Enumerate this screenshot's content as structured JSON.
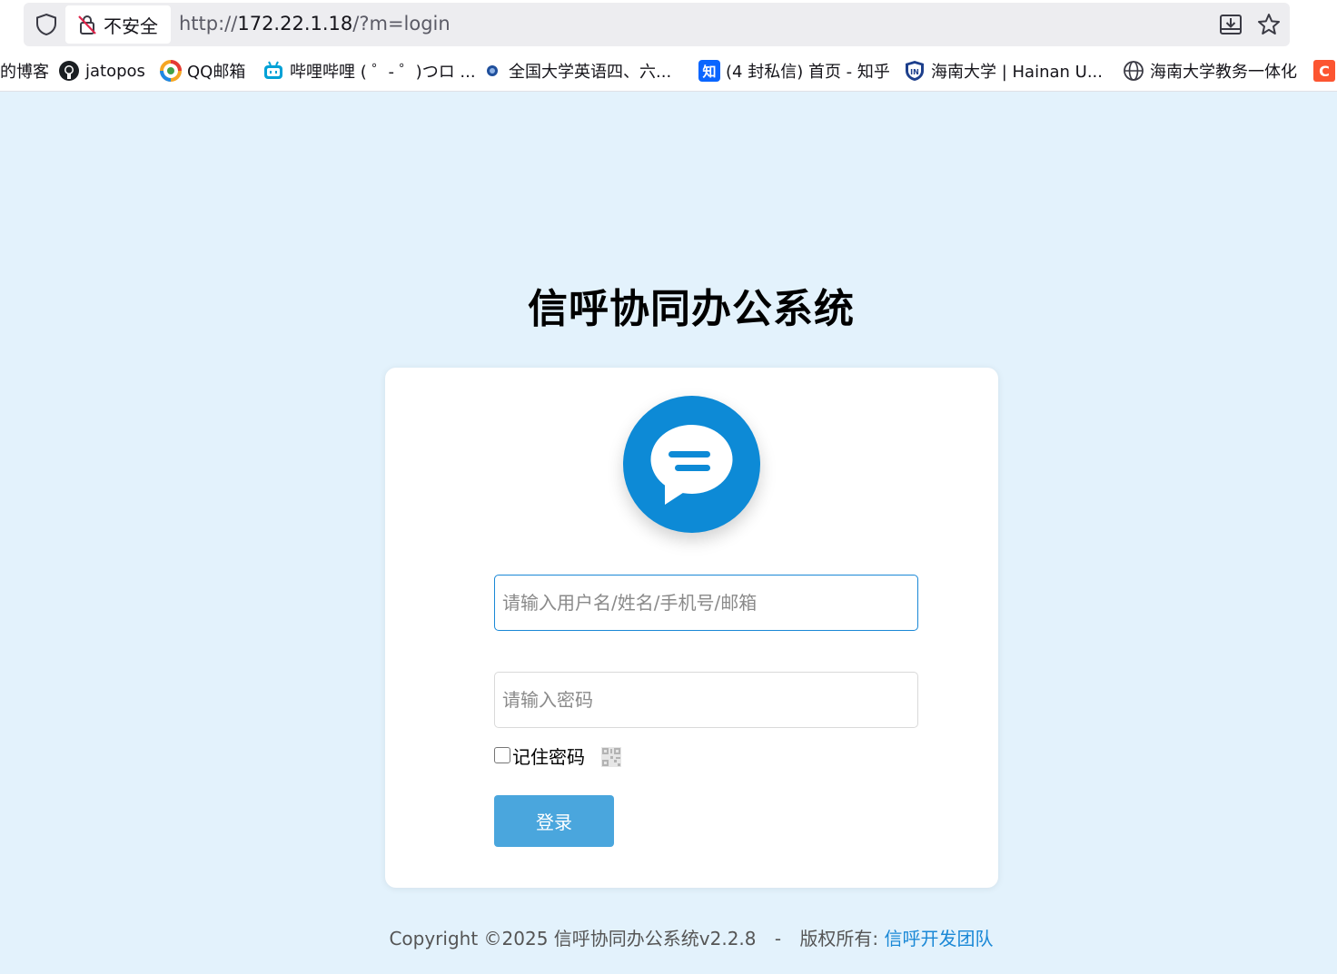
{
  "browser": {
    "security_label": "不安全",
    "url_prefix": "http://",
    "url_host": "172.22.1.18",
    "url_path": "/?m=login"
  },
  "bookmarks": [
    {
      "label": "的博客",
      "icon": "blog-icon"
    },
    {
      "label": "jatopos",
      "icon": "github-icon"
    },
    {
      "label": "QQ邮箱",
      "icon": "qqmail-icon"
    },
    {
      "label": "哔哩哔哩 ( ゜- ゜)つロ ...",
      "icon": "bilibili-icon"
    },
    {
      "label": "全国大学英语四、六...",
      "icon": "cet-icon"
    },
    {
      "label": "(4 封私信) 首页 - 知乎",
      "icon": "zhihu-icon"
    },
    {
      "label": "海南大学 | Hainan U...",
      "icon": "hainan-university-icon"
    },
    {
      "label": "海南大学教务一体化",
      "icon": "globe-icon"
    }
  ],
  "page": {
    "title": "信呼协同办公系统"
  },
  "form": {
    "username_placeholder": "请输入用户名/姓名/手机号/邮箱",
    "password_placeholder": "请输入密码",
    "remember_label": "记住密码",
    "login_label": "登录"
  },
  "footer": {
    "copyright": "Copyright ©2025 信呼协同办公系统v2.2.8",
    "separator": "-",
    "rights": "版权所有:",
    "team": "信呼开发团队"
  },
  "colors": {
    "page_bg": "#e3f2fc",
    "logo_blue": "#0d8ad6",
    "button_blue": "#4aa6dd",
    "link_blue": "#1a88d6"
  }
}
